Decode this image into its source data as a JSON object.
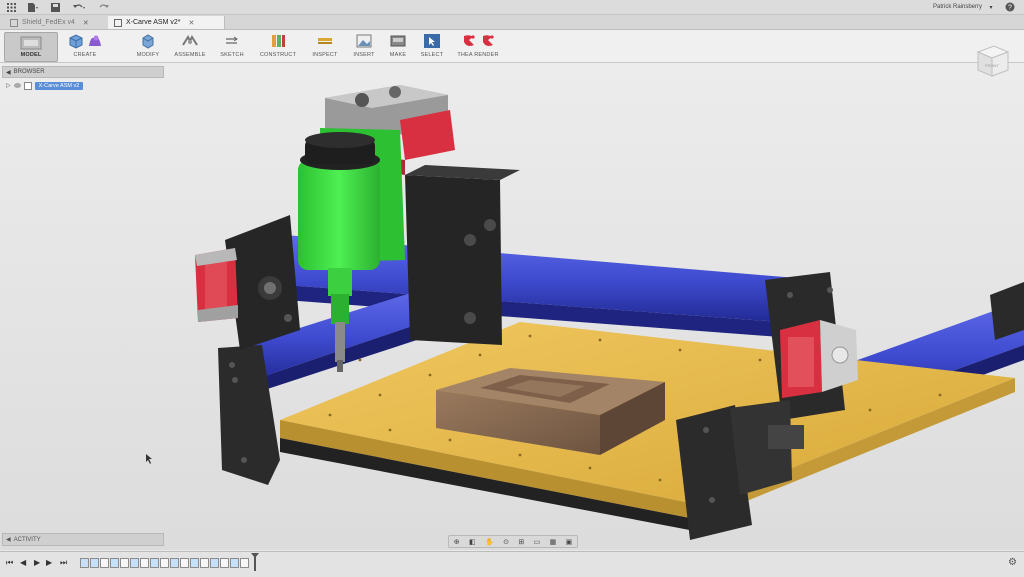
{
  "app": {
    "user_name": "Patrick Rainsberry"
  },
  "tabs": [
    {
      "label": "Shield_FedEx v4",
      "active": false
    },
    {
      "label": "X-Carve ASM v2*",
      "active": true
    }
  ],
  "toolbar": {
    "workspace_label": "MODEL",
    "groups": [
      {
        "label": "CREATE"
      },
      {
        "label": "MODIFY"
      },
      {
        "label": "ASSEMBLE"
      },
      {
        "label": "SKETCH"
      },
      {
        "label": "CONSTRUCT"
      },
      {
        "label": "INSPECT"
      },
      {
        "label": "INSERT"
      },
      {
        "label": "MAKE"
      },
      {
        "label": "SELECT"
      },
      {
        "label": "THEA RENDER"
      }
    ]
  },
  "browser": {
    "title": "BROWSER",
    "document_node": "X-Carve ASM v2"
  },
  "viewcube": {
    "face_label": "FRONT"
  },
  "activity": {
    "label": "ACTIVITY"
  },
  "colors": {
    "accent": "#5a8ed8",
    "spindle_green": "#36e03a",
    "rail_blue": "#3f4bd0",
    "motor_red": "#d83040",
    "bed_yellow": "#e5b94e",
    "frame_black": "#2a2a2a",
    "wood": "#8a6a4e"
  }
}
